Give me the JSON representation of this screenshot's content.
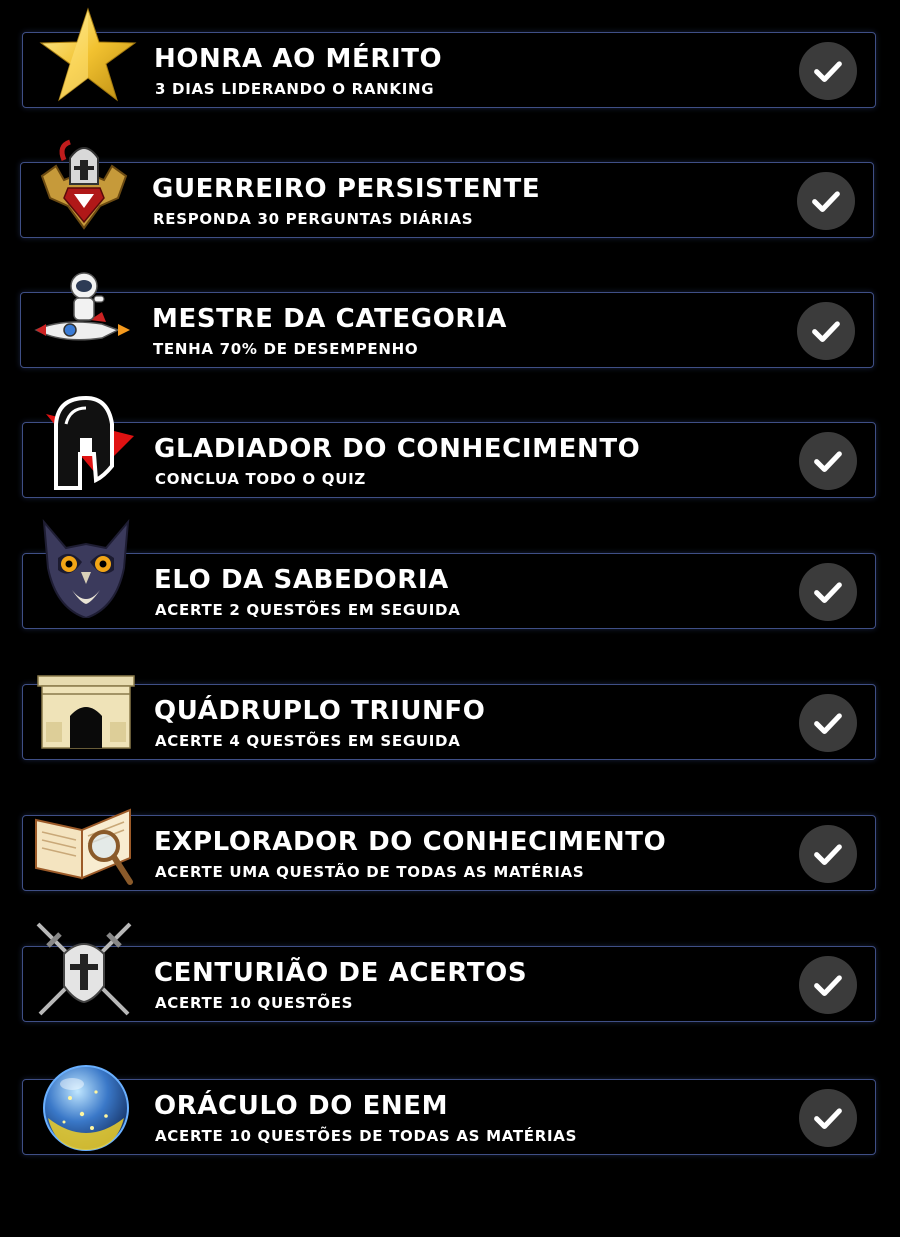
{
  "achievements": [
    {
      "title": "HONRA AO MÉRITO",
      "subtitle": "3 DIAS LIDERANDO O RANKING",
      "icon": "gold-star-icon",
      "completed": true
    },
    {
      "title": "GUERREIRO PERSISTENTE",
      "subtitle": "RESPONDA 30 PERGUNTAS DIÁRIAS",
      "icon": "knight-crest-icon",
      "completed": true
    },
    {
      "title": "MESTRE DA CATEGORIA",
      "subtitle": "TENHA 70% DE DESEMPENHO",
      "icon": "astronaut-rocket-icon",
      "completed": true
    },
    {
      "title": "GLADIADOR DO CONHECIMENTO",
      "subtitle": "CONCLUA TODO O QUIZ",
      "icon": "spartan-helmet-icon",
      "completed": true
    },
    {
      "title": "ELO DA SABEDORIA",
      "subtitle": "ACERTE 2 QUESTÕES EM SEGUIDA",
      "icon": "owl-icon",
      "completed": true
    },
    {
      "title": "QUÁDRUPLO TRIUNFO",
      "subtitle": "ACERTE 4 QUESTÕES EM SEGUIDA",
      "icon": "triumphal-arch-icon",
      "completed": true
    },
    {
      "title": "EXPLORADOR DO CONHECIMENTO",
      "subtitle": "ACERTE UMA QUESTÃO DE TODAS AS MATÉRIAS",
      "icon": "book-magnifier-icon",
      "completed": true
    },
    {
      "title": "CENTURIÃO DE ACERTOS",
      "subtitle": "ACERTE 10 QUESTÕES",
      "icon": "crossed-swords-helmet-icon",
      "completed": true
    },
    {
      "title": "ORÁCULO DO ENEM",
      "subtitle": "ACERTE 10 QUESTÕES DE TODAS AS MATÉRIAS",
      "icon": "crystal-ball-icon",
      "completed": true
    }
  ],
  "colors": {
    "background": "#000000",
    "card_border": "#3f4f86",
    "check_bg": "#3b3b3b",
    "text": "#ffffff"
  }
}
